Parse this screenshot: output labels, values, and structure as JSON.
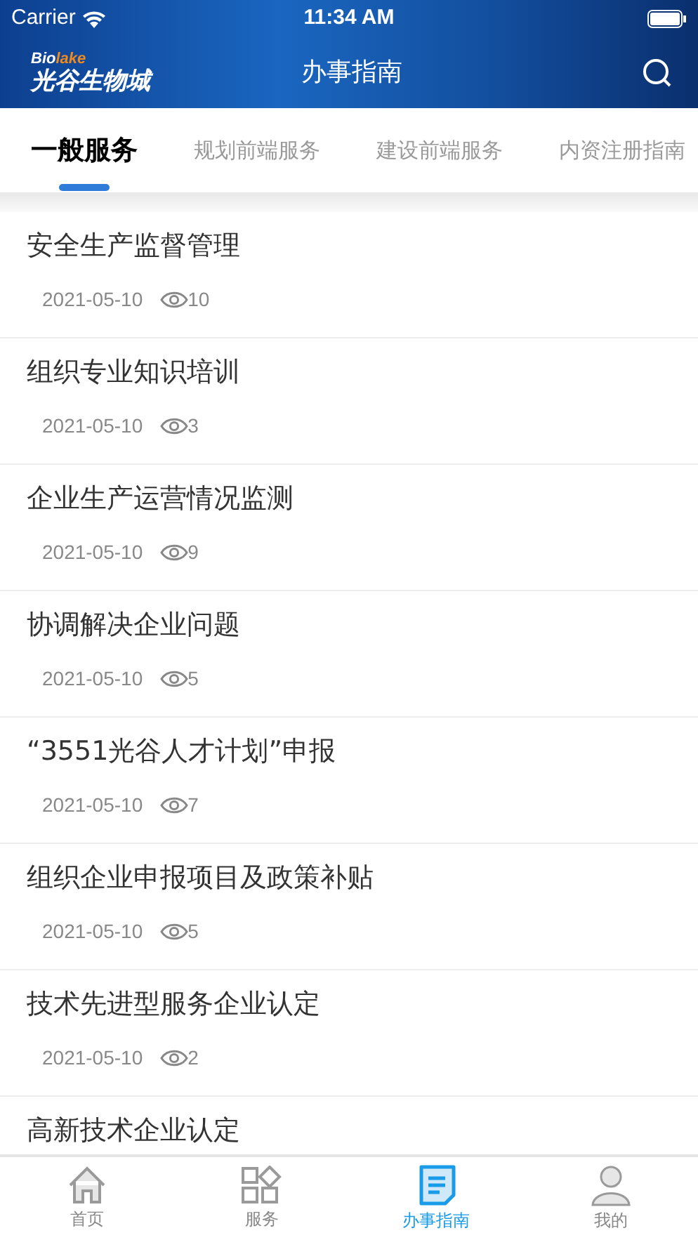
{
  "status_bar": {
    "carrier": "Carrier",
    "time": "11:34 AM"
  },
  "header": {
    "logo_top_a": "Bio",
    "logo_top_b": "lake",
    "logo_name": "光谷生物城",
    "title": "办事指南"
  },
  "tabs": [
    {
      "label": "一般服务",
      "selected": true
    },
    {
      "label": "规划前端服务",
      "selected": false
    },
    {
      "label": "建设前端服务",
      "selected": false
    },
    {
      "label": "内资注册指南",
      "selected": false
    }
  ],
  "items": [
    {
      "title": "安全生产监督管理",
      "date": "2021-05-10",
      "views": "10"
    },
    {
      "title": "组织专业知识培训",
      "date": "2021-05-10",
      "views": "3"
    },
    {
      "title": "企业生产运营情况监测",
      "date": "2021-05-10",
      "views": "9"
    },
    {
      "title": "协调解决企业问题",
      "date": "2021-05-10",
      "views": "5"
    },
    {
      "title": "“3551光谷人才计划”申报",
      "date": "2021-05-10",
      "views": "7"
    },
    {
      "title": "组织企业申报项目及政策补贴",
      "date": "2021-05-10",
      "views": "5"
    },
    {
      "title": "技术先进型服务企业认定",
      "date": "2021-05-10",
      "views": "2"
    },
    {
      "title": "高新技术企业认定"
    }
  ],
  "tab_bar": [
    {
      "kind": "home",
      "label": "首页",
      "selected": false
    },
    {
      "kind": "services",
      "label": "服务",
      "selected": false
    },
    {
      "kind": "guide",
      "label": "办事指南",
      "selected": true
    },
    {
      "kind": "profile",
      "label": "我的",
      "selected": false
    }
  ]
}
